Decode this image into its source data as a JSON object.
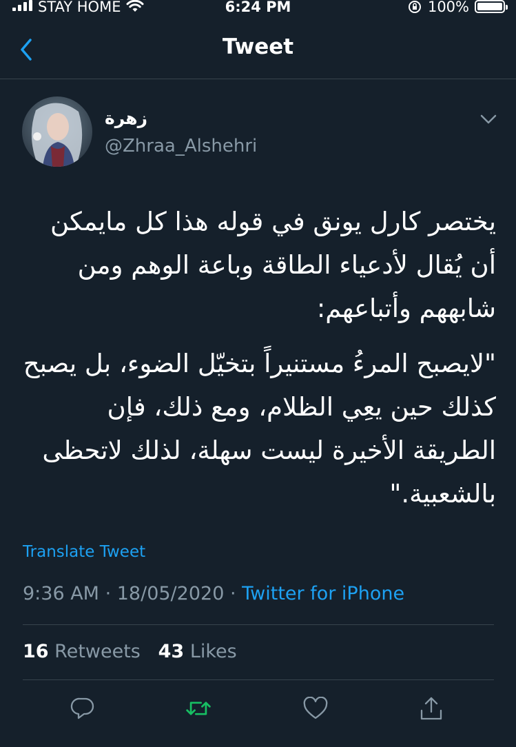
{
  "status_bar": {
    "carrier": "STAY HOME",
    "time": "6:24 PM",
    "battery": "100%"
  },
  "nav": {
    "title": "Tweet"
  },
  "tweet": {
    "display_name": "زهرة",
    "handle": "@Zhraa_Alshehri",
    "paragraphs": [
      "يختصر كارل يونق في قوله هذا كل مايمكن أن يُقال لأدعياء الطاقة وباعة الوهم ومن شابههم وأتباعهم:",
      "\"لايصبح المرءُ مستنيراً بتخيّل الضوء، بل يصبح كذلك حين يعِي الظلام، ومع ذلك، فإن الطريقة الأخيرة ليست سهلة، لذلك لاتحظى بالشعبية.\""
    ],
    "translate_label": "Translate Tweet",
    "time": "9:36 AM",
    "date": "18/05/2020",
    "source": "Twitter for iPhone",
    "retweets_count": "16",
    "retweets_label": "Retweets",
    "likes_count": "43",
    "likes_label": "Likes"
  },
  "actions": {
    "reply_icon": "reply-icon",
    "retweet_icon": "retweet-icon",
    "like_icon": "heart-icon",
    "share_icon": "share-icon"
  },
  "colors": {
    "background": "#15202b",
    "accent": "#1da1f2",
    "secondary_text": "#8899a6",
    "retweeted": "#17bf63",
    "divider": "#38444d"
  }
}
